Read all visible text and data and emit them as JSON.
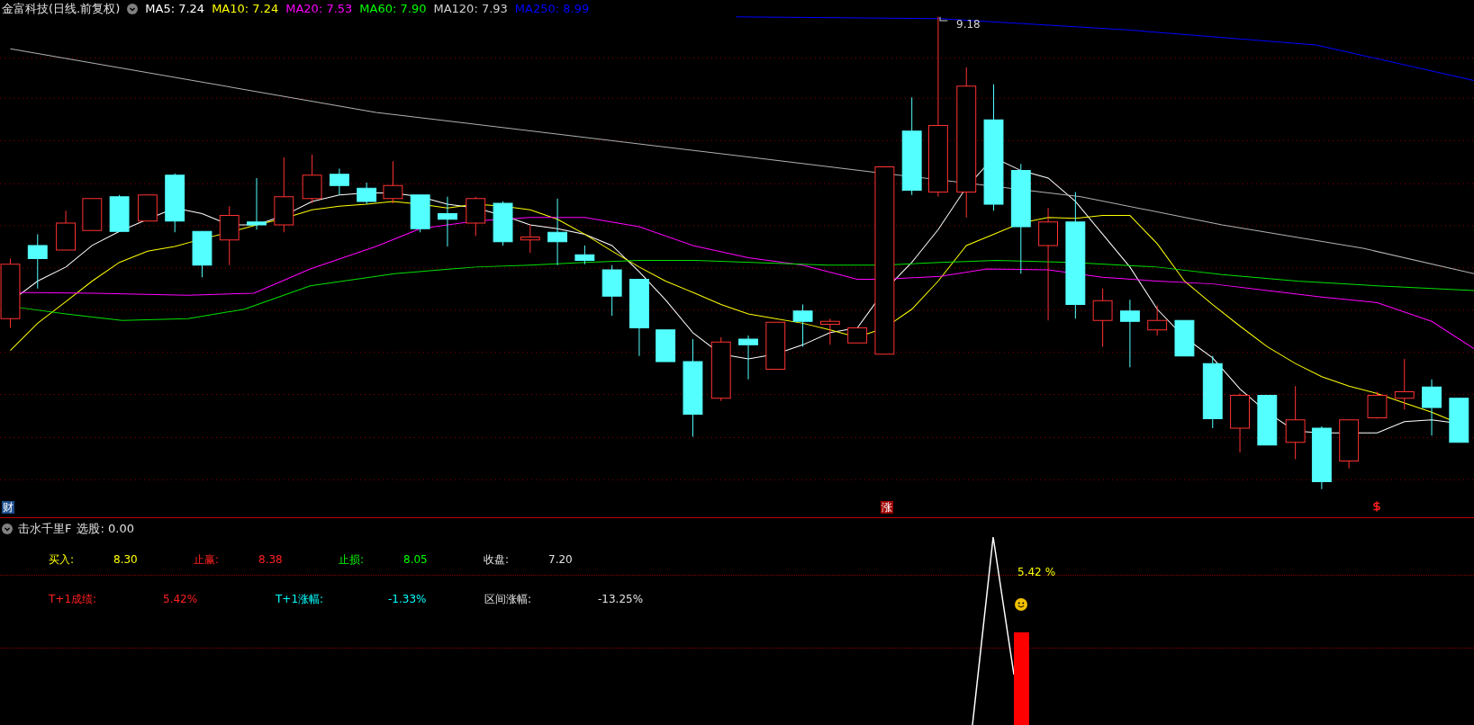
{
  "legend": {
    "title": "金富科技(日线.前复权)",
    "items": [
      {
        "label": "MA5: 7.24",
        "color": "#ffffff"
      },
      {
        "label": "MA10: 7.24",
        "color": "#ffff00"
      },
      {
        "label": "MA20: 7.53",
        "color": "#ff00ff"
      },
      {
        "label": "MA60: 7.90",
        "color": "#00ff00"
      },
      {
        "label": "MA120: 7.93",
        "color": "#d0d0d0"
      },
      {
        "label": "MA250: 8.99",
        "color": "#0000ff"
      }
    ]
  },
  "main_chart": {
    "high_label": "9.18",
    "markers": [
      {
        "kind": "badge",
        "text": "财",
        "color": "#1f4f8f"
      },
      {
        "kind": "badge",
        "text": "涨",
        "color": "#a00000"
      },
      {
        "kind": "dollar"
      }
    ]
  },
  "indicator": {
    "name": "击水千里F",
    "reading": "选股: 0.00",
    "stat_lines": [
      [
        {
          "label": "买入:",
          "value": "8.30",
          "color": "#ffff00"
        },
        {
          "label": "止赢:",
          "value": "8.38",
          "color": "#ff2020"
        },
        {
          "label": "止损:",
          "value": "8.05",
          "color": "#00ff00"
        },
        {
          "label": "收盘:",
          "value": "7.20",
          "color": "#e0e0e0"
        }
      ],
      [
        {
          "label": "T+1成绩:",
          "value": "5.42%",
          "color": "#ff2020"
        },
        {
          "label": "T+1涨幅:",
          "value": "-1.33%",
          "color": "#00ffff"
        },
        {
          "label": "区间涨幅:",
          "value": "-13.25%",
          "color": "#e0e0e0"
        }
      ]
    ],
    "score": "5.42",
    "score_unit": "%"
  }
}
